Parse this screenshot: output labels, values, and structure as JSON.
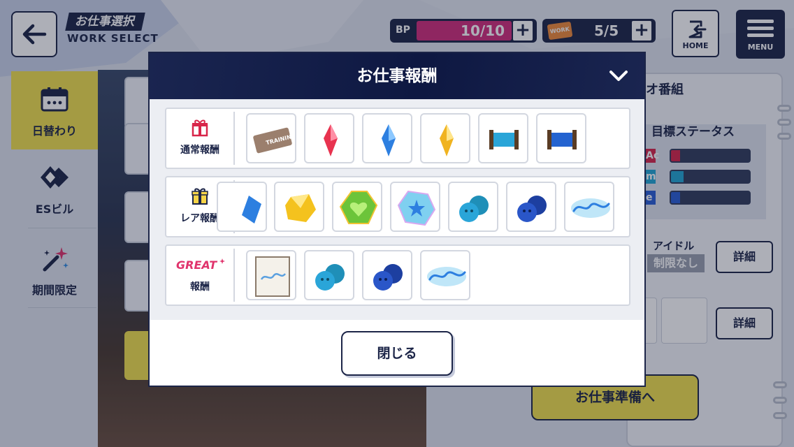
{
  "header": {
    "title_jp": "お仕事選択",
    "title_en": "WORK SELECT",
    "bp_label": "BP",
    "bp_value": "10/10",
    "bp_fill_fraction": 1.0,
    "work_ticket_label": "WORK",
    "work_value": "5/5",
    "home_label": "HOME",
    "menu_label": "MENU"
  },
  "sidebar": {
    "items": [
      {
        "label": "日替わり",
        "icon": "calendar-icon",
        "active": true
      },
      {
        "label": "ESビル",
        "icon": "es-building-icon",
        "active": false
      },
      {
        "label": "期間限定",
        "icon": "sparkle-wand-icon",
        "active": false
      }
    ]
  },
  "right_panel": {
    "title_partial": "オ番組",
    "status_title": "目標ステータス",
    "stats": [
      {
        "tag": "Ac",
        "color": "#d8264a",
        "level": 0.12
      },
      {
        "tag": "m",
        "color": "#23a6d5",
        "level": 0.16
      },
      {
        "tag": "e",
        "color": "#2a5fd6",
        "level": 0.12
      }
    ],
    "idol_label": "アイドル",
    "idol_value": "制限なし",
    "detail_label": "詳細",
    "prep_button": "お仕事準備へ"
  },
  "modal": {
    "title": "お仕事報酬",
    "close_label": "閉じる",
    "rows": [
      {
        "label": "通常報酬",
        "icon": "gift-red-icon",
        "items": [
          "training-ticket-icon",
          "red-gem-icon",
          "blue-gem-icon",
          "yellow-gem-icon",
          "teal-thread-spool-icon",
          "blue-thread-spool-icon"
        ]
      },
      {
        "label": "レア報酬",
        "icon": "gift-yellow-icon",
        "items": [
          "blue-gem-partial-icon",
          "yellow-crystal-icon",
          "green-heart-jewel-icon",
          "blue-star-jewel-icon",
          "teal-buttons-icon",
          "navy-buttons-icon",
          "rabits-logo-icon"
        ]
      },
      {
        "label_badge": "GREAT",
        "label": "報酬",
        "icon": "great-badge-icon",
        "items": [
          "rabits-photo-icon",
          "teal-buttons-icon",
          "navy-buttons-icon",
          "rabits-logo-icon"
        ]
      }
    ]
  },
  "colors": {
    "navy": "#1c2548",
    "accent_yellow": "#f2e14d",
    "bp_pink": "#d22d7c"
  }
}
